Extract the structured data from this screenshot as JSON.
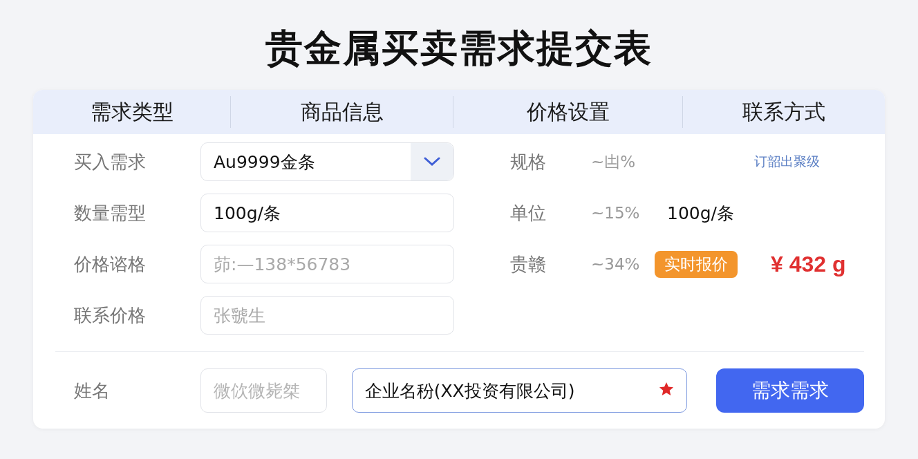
{
  "title": "贵金属买卖需求提交表",
  "headers": [
    "需求类型",
    "商品信息",
    "价格设置",
    "联系方式"
  ],
  "left_rows": [
    {
      "label": "买入需求",
      "kind": "select",
      "value": "Au9999金条"
    },
    {
      "label": "数量需型",
      "kind": "input",
      "value": "100g/条"
    },
    {
      "label": "价格谘格",
      "kind": "input",
      "placeholder": "茆:—138*56783"
    },
    {
      "label": "联系价格",
      "kind": "input",
      "placeholder": "张虢生"
    }
  ],
  "right_rows": [
    {
      "label": "规格",
      "reading": "~凷%",
      "note": "订韶出聚级"
    },
    {
      "label": "单位",
      "reading": "~15%",
      "value": "100g/条"
    },
    {
      "label": "贵赣",
      "reading": "~34%",
      "badge": "实时报价",
      "price": "¥ 432 g"
    }
  ],
  "bottom": {
    "label": "姓名",
    "wechat": {
      "placeholder": "微佽微毙桀"
    },
    "company": {
      "value": "企业名秎(XX投资有限公司)",
      "required": true
    },
    "button": "需求需求"
  }
}
